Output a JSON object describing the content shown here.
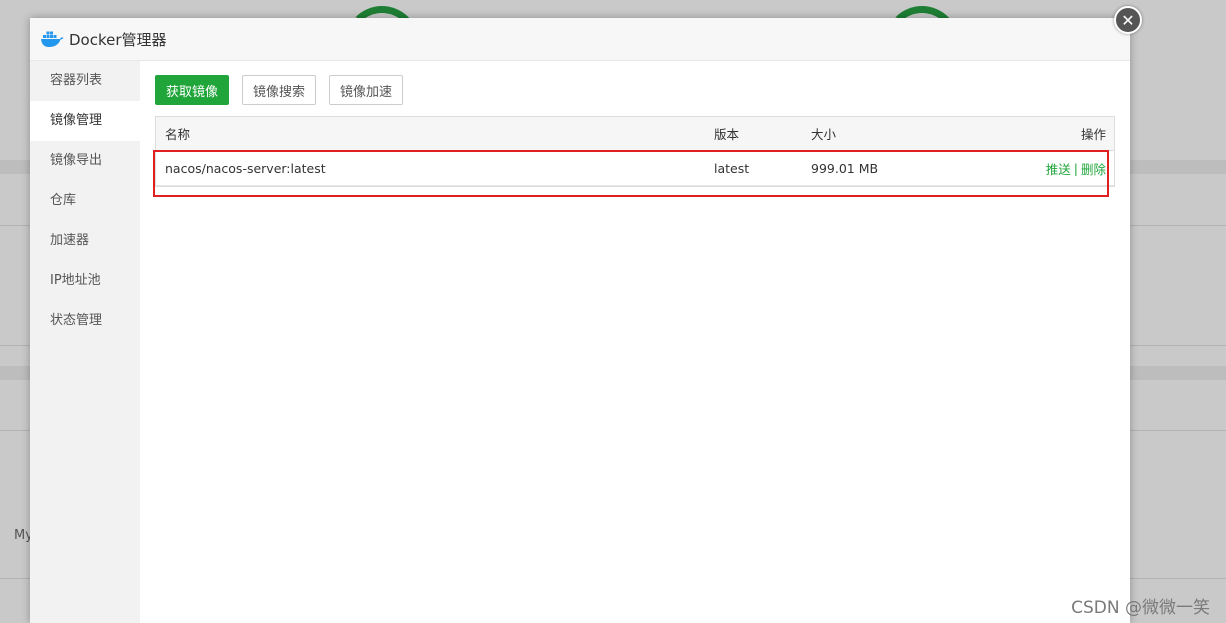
{
  "background": {
    "partial_text": "My"
  },
  "modal": {
    "title": "Docker管理器",
    "close_glyph": "✕"
  },
  "sidebar": {
    "items": [
      {
        "label": "容器列表"
      },
      {
        "label": "镜像管理",
        "active": true
      },
      {
        "label": "镜像导出"
      },
      {
        "label": "仓库"
      },
      {
        "label": "加速器"
      },
      {
        "label": "IP地址池"
      },
      {
        "label": "状态管理"
      }
    ]
  },
  "toolbar": {
    "pull_label": "获取镜像",
    "search_label": "镜像搜索",
    "accelerate_label": "镜像加速"
  },
  "table": {
    "headers": {
      "name": "名称",
      "version": "版本",
      "size": "大小",
      "action": "操作"
    },
    "rows": [
      {
        "name": "nacos/nacos-server:latest",
        "version": "latest",
        "size": "999.01 MB",
        "push": "推送",
        "sep": "|",
        "delete": "删除"
      }
    ]
  },
  "watermark": "CSDN @微微一笑",
  "colors": {
    "accent": "#20a53a",
    "highlight": "#e02020"
  }
}
